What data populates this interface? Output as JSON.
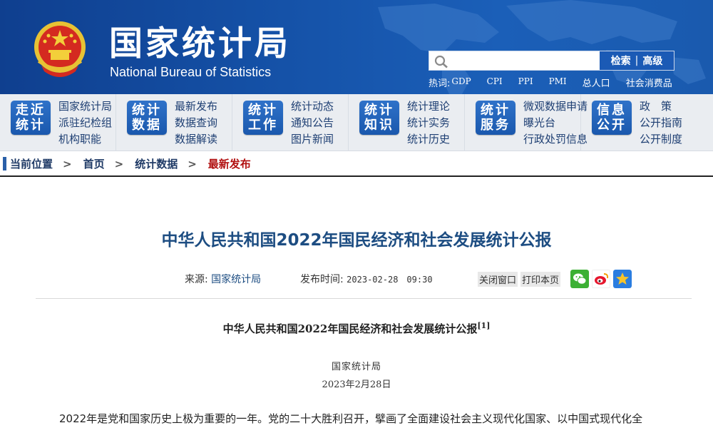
{
  "header": {
    "site_name": "国家统计局",
    "site_name_en": "National Bureau of Statistics",
    "search": {
      "placeholder": "",
      "search_label": "检索",
      "advanced_label": "高级"
    },
    "hotwords_label": "热词:",
    "hotwords": [
      "GDP",
      "CPI",
      "PPI",
      "PMI",
      "总人口",
      "社会消费品"
    ]
  },
  "nav": [
    {
      "tile": [
        "走近",
        "统计"
      ],
      "links": [
        "国家统计局",
        "派驻纪检组",
        "机构职能"
      ]
    },
    {
      "tile": [
        "统计",
        "数据"
      ],
      "links": [
        "最新发布",
        "数据查询",
        "数据解读"
      ]
    },
    {
      "tile": [
        "统计",
        "工作"
      ],
      "links": [
        "统计动态",
        "通知公告",
        "图片新闻"
      ]
    },
    {
      "tile": [
        "统计",
        "知识"
      ],
      "links": [
        "统计理论",
        "统计实务",
        "统计历史"
      ]
    },
    {
      "tile": [
        "统计",
        "服务"
      ],
      "links": [
        "微观数据申请",
        "曝光台",
        "行政处罚信息"
      ]
    },
    {
      "tile": [
        "信息",
        "公开"
      ],
      "links": [
        "政　策",
        "公开指南",
        "公开制度"
      ]
    }
  ],
  "breadcrumb": {
    "label": "当前位置",
    "items": [
      "首页",
      "统计数据",
      "最新发布"
    ]
  },
  "article": {
    "title": "中华人民共和国2022年国民经济和社会发展统计公报",
    "source_label": "来源:",
    "source": "国家统计局",
    "time_label": "发布时间:",
    "time": "2023-02-28　09:30",
    "close_label": "关闭窗口",
    "print_label": "打印本页",
    "share_icons": [
      "wechat-icon",
      "weibo-icon",
      "favorite-star-icon"
    ],
    "doc_title": "中华人民共和国2022年国民经济和社会发展统计公报",
    "doc_title_note": "[1]",
    "issuer": "国家统计局",
    "date": "2023年2月28日",
    "first_paragraph": "2022年是党和国家历史上极为重要的一年。党的二十大胜利召开，擘画了全面建设社会主义现代化国家、以中国式现代化全"
  },
  "colors": {
    "header_blue": "#1552a8",
    "nav_tile_blue": "#2266bd",
    "title_blue": "#1d4d82",
    "current_crumb_red": "#b10f0f"
  }
}
